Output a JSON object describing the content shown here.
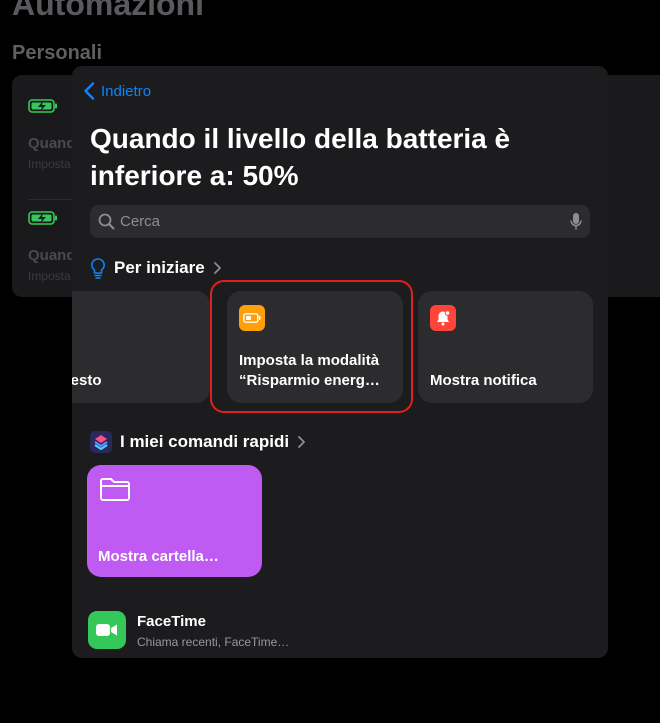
{
  "background": {
    "title": "Automazioni",
    "section": "Personali",
    "rows": [
      {
        "title": "Quando",
        "subtitle": "Imposta"
      },
      {
        "title": "Quand",
        "subtitle": "Imposta"
      }
    ]
  },
  "sheet": {
    "back_label": "Indietro",
    "title": "Quando il livello della batteria è inferiore a: 50%",
    "search_placeholder": "Cerca",
    "sections": {
      "get_started": "Per iniziare",
      "my_shortcuts": "I miei comandi rapidi"
    },
    "suggestions": [
      {
        "label": "ıgi testo",
        "icon": "pencil-icon",
        "color": "#ff453a"
      },
      {
        "label": "Imposta la modalità “Risparmio energ…",
        "icon": "battery-icon",
        "color": "#ff9f0a"
      },
      {
        "label": "Mostra notifica",
        "icon": "bell-icon",
        "color": "#ff453a"
      }
    ],
    "shortcut": {
      "label": "Mostra cartella…",
      "icon": "folder-icon",
      "color": "#bf5af2"
    },
    "app": {
      "name": "FaceTime",
      "subtitle": "Chiama recenti, FaceTime…",
      "icon": "facetime-icon",
      "color": "#34c759"
    }
  }
}
